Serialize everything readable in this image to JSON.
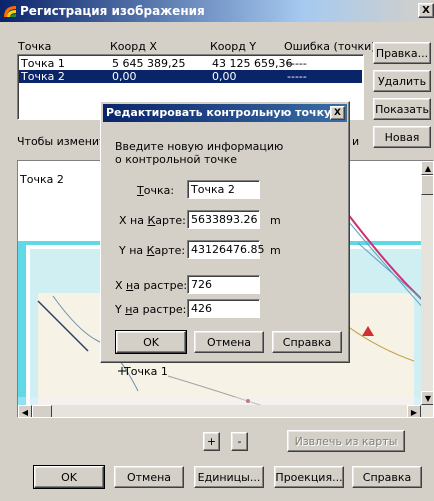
{
  "window": {
    "title": "Регистрация изображения",
    "close_glyph": "X"
  },
  "table": {
    "headers": [
      "Точка",
      "Коорд X",
      "Коорд Y",
      "Ошибка (точки)"
    ],
    "rows": [
      {
        "point": "Точка 1",
        "x": "5 645 389,25",
        "y": "43 125 659,36",
        "error": "-----",
        "selected": false
      },
      {
        "point": "Точка 2",
        "x": "0,00",
        "y": "0,00",
        "error": "-----",
        "selected": true
      }
    ]
  },
  "side_buttons": {
    "edit": "Правка...",
    "delete": "Удалить",
    "show": "Показать",
    "new": "Новая"
  },
  "hint_text": "Чтобы изменит",
  "hint_tail": "и",
  "map": {
    "point_list_label": "Точка 2",
    "marker_label": "Точка 1"
  },
  "zoom": {
    "plus": "+",
    "minus": "-"
  },
  "extract_button": "Извлечь из карты",
  "bottom_buttons": {
    "ok": "OK",
    "cancel": "Отмена",
    "units": "Единицы...",
    "projection": "Проекция...",
    "help": "Справка"
  },
  "dialog": {
    "title": "Редактировать контрольную точку",
    "close_glyph": "X",
    "prompt": "Введите новую информацию о контрольной точке",
    "point_label": "Точка:",
    "point_value": "Точка 2",
    "map_x_label": "X на Карте:",
    "map_x_value": "5633893.26",
    "map_y_label": "Y на Карте:",
    "map_y_value": "43126476.85",
    "unit": "m",
    "raster_x_label": "X на растре:",
    "raster_x_value": "726",
    "raster_y_label": "Y на растре:",
    "raster_y_value": "426",
    "ok": "OK",
    "cancel": "Отмена",
    "help": "Справка"
  }
}
